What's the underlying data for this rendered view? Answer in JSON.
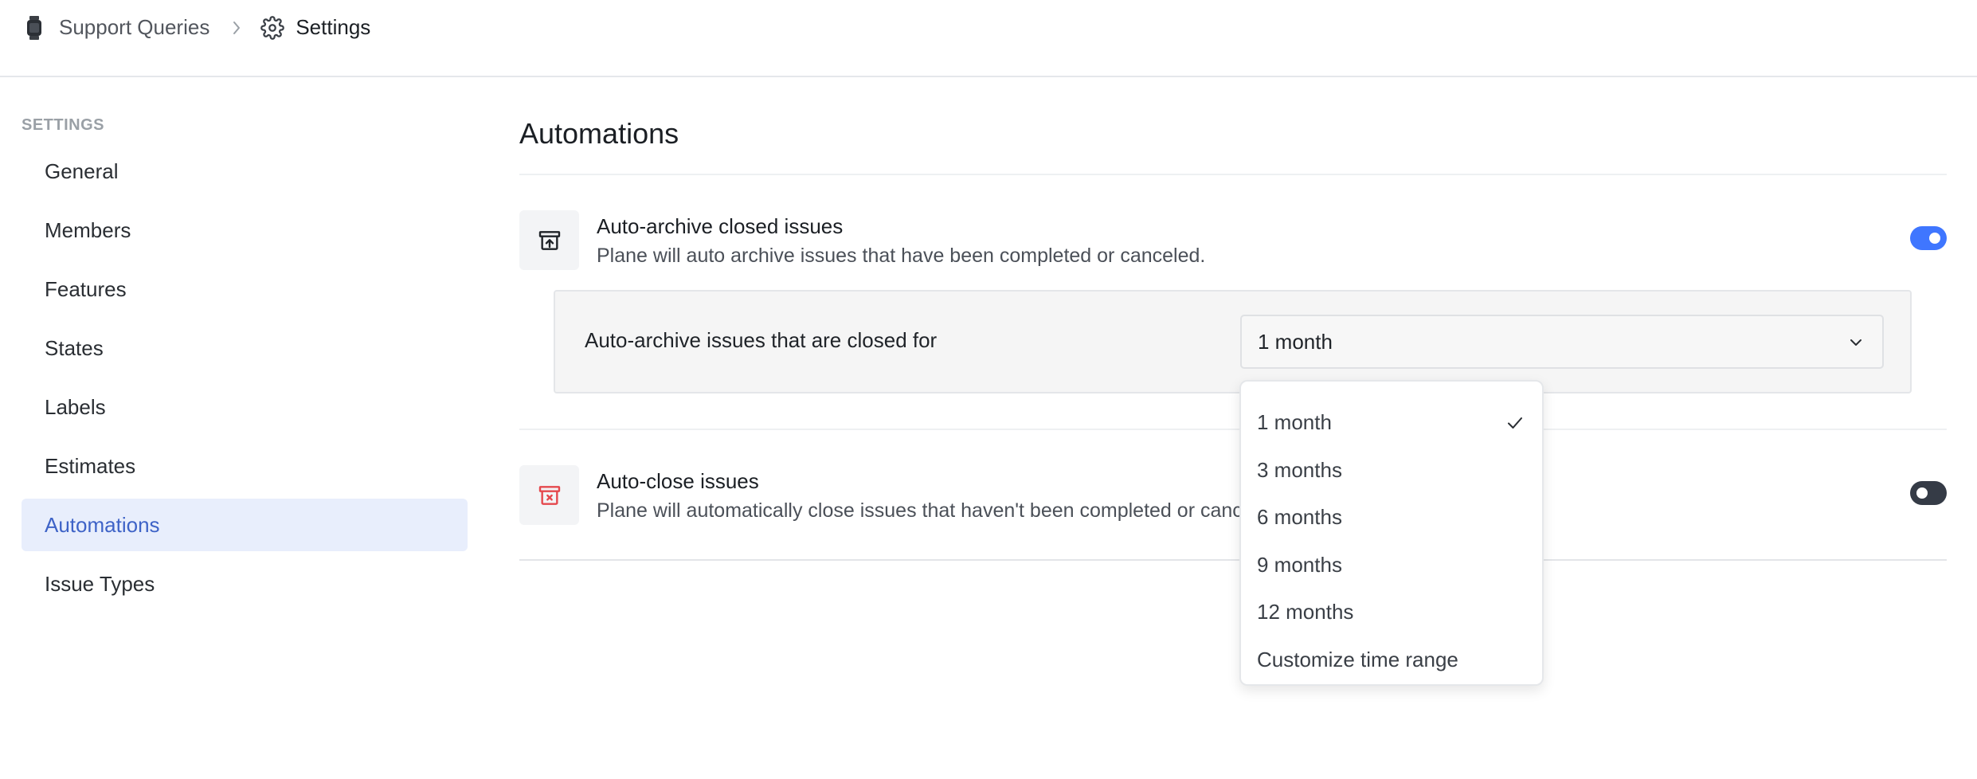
{
  "breadcrumb": {
    "project": "Support Queries",
    "page": "Settings"
  },
  "sidebar": {
    "heading": "SETTINGS",
    "items": [
      {
        "label": "General",
        "active": false
      },
      {
        "label": "Members",
        "active": false
      },
      {
        "label": "Features",
        "active": false
      },
      {
        "label": "States",
        "active": false
      },
      {
        "label": "Labels",
        "active": false
      },
      {
        "label": "Estimates",
        "active": false
      },
      {
        "label": "Automations",
        "active": true
      },
      {
        "label": "Issue Types",
        "active": false
      }
    ]
  },
  "main": {
    "title": "Automations",
    "auto_archive": {
      "title": "Auto-archive closed issues",
      "description": "Plane will auto archive issues that have been completed or canceled.",
      "enabled": true,
      "panel_label": "Auto-archive issues that are closed for",
      "selected": "1 month"
    },
    "auto_close": {
      "title": "Auto-close issues",
      "description": "Plane will automatically close issues that haven't been completed or canceled.",
      "enabled": false
    }
  },
  "dropdown": {
    "options": [
      "1 month",
      "3 months",
      "6 months",
      "9 months",
      "12 months",
      "Customize time range"
    ],
    "selected": "1 month"
  },
  "colors": {
    "accent": "#3f76ff",
    "active_nav_bg": "#e8eefc",
    "active_nav_text": "#3e63c7",
    "toggle_off": "#353b46",
    "auto_close_icon": "#e5484d"
  }
}
